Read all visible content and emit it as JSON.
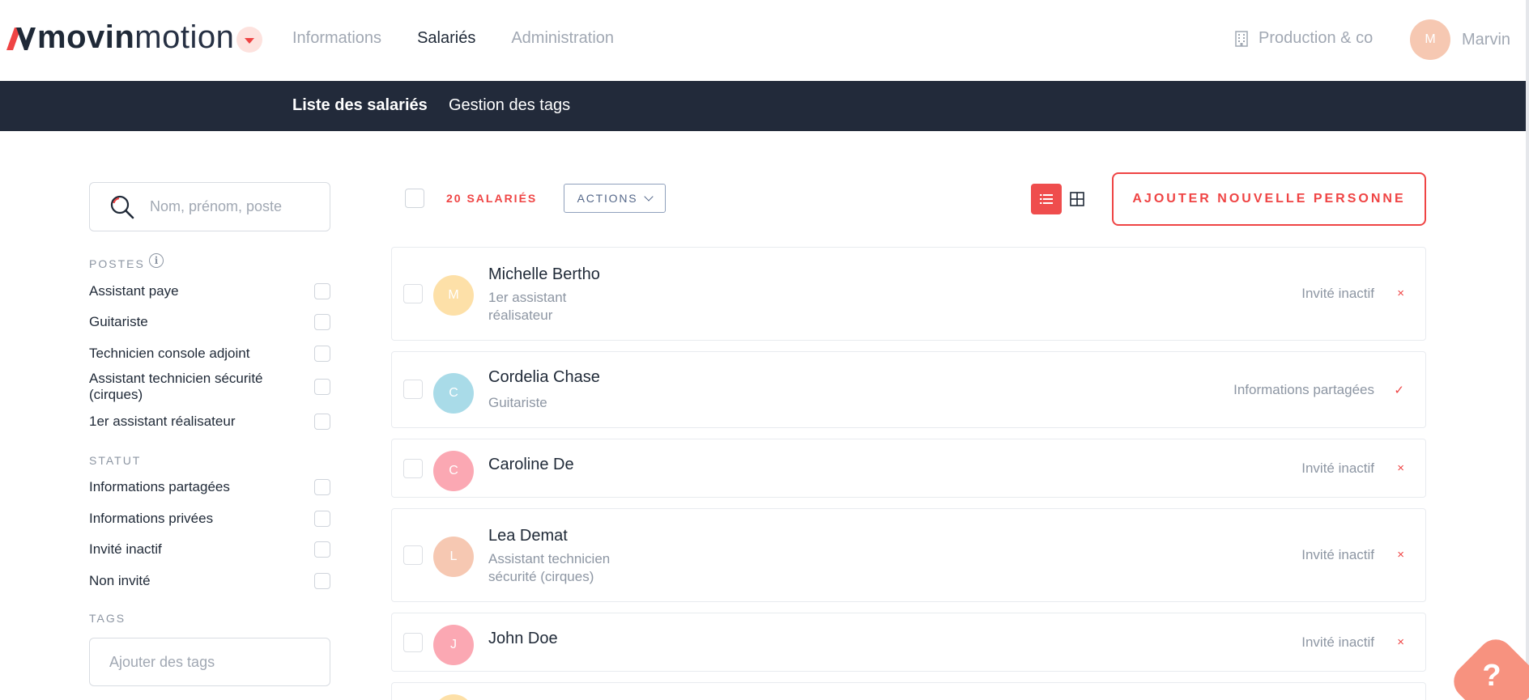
{
  "header": {
    "logo": {
      "bold": "movin",
      "light": "motion",
      "mark_letter": "M"
    },
    "nav": [
      "Informations",
      "Salariés",
      "Administration"
    ],
    "active_nav": "Salariés",
    "company": "Production & co",
    "user": {
      "initial": "M",
      "name": "Marvin"
    }
  },
  "subnav": {
    "tabs": [
      "Liste des salariés",
      "Gestion des tags"
    ]
  },
  "sidebar": {
    "search_placeholder": "Nom, prénom, poste",
    "postes_title": "POSTES",
    "postes": [
      "Assistant paye",
      "Guitariste",
      "Technicien console adjoint",
      "Assistant technicien sécurité (cirques)",
      "1er assistant réalisateur"
    ],
    "statut_title": "STATUT",
    "statuts": [
      "Informations partagées",
      "Informations privées",
      "Invité inactif",
      "Non invité"
    ],
    "tags_title": "TAGS",
    "tags_placeholder": "Ajouter des tags"
  },
  "toolbar": {
    "count": "20 SALARIÉS",
    "actions_label": "ACTIONS",
    "add_label": "AJOUTER NOUVELLE PERSONNE"
  },
  "employees": [
    {
      "initial": "M",
      "name": "Michelle Bertho",
      "role": "1er assistant réalisateur",
      "status": "Invité inactif",
      "mark": "×",
      "color": "#fde0a8"
    },
    {
      "initial": "C",
      "name": "Cordelia Chase",
      "role": "Guitariste",
      "status": "Informations partagées",
      "mark": "✓",
      "color": "#a9dbe8"
    },
    {
      "initial": "C",
      "name": "Caroline De",
      "role": "",
      "status": "Invité inactif",
      "mark": "×",
      "color": "#fba8b3"
    },
    {
      "initial": "L",
      "name": "Lea Demat",
      "role": "Assistant technicien sécurité (cirques)",
      "status": "Invité inactif",
      "mark": "×",
      "color": "#f6c8b2"
    },
    {
      "initial": "J",
      "name": "John Doe",
      "role": "",
      "status": "Invité inactif",
      "mark": "×",
      "color": "#fba8b3"
    }
  ],
  "help": {
    "label": "?"
  },
  "colors": {
    "accent": "#ef4444",
    "subnav": "#222a3a",
    "muted": "#a1a8b3"
  },
  "icons": {
    "search": "search-icon",
    "info": "info-icon",
    "list_view": "list-view-icon",
    "grid_view": "grid-view-icon",
    "building": "building-icon",
    "dropdown": "caret-down-icon"
  }
}
